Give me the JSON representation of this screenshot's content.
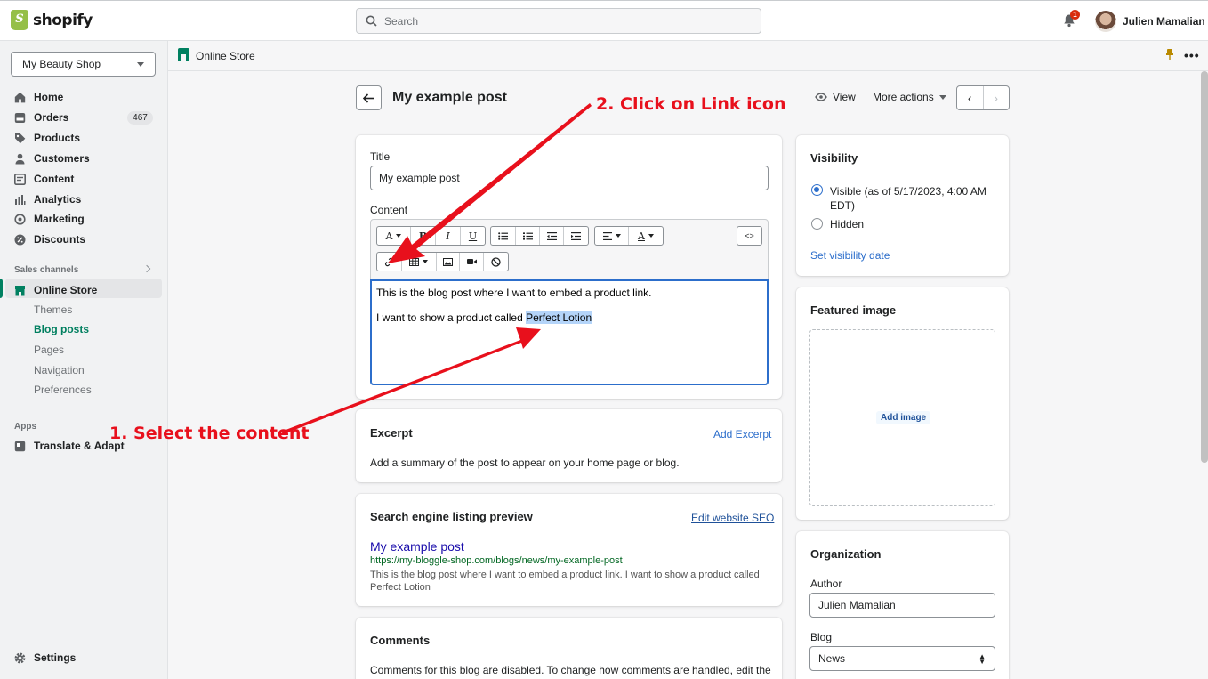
{
  "topbar": {
    "brand": "shopify",
    "search_placeholder": "Search",
    "notification_count": "1",
    "user_name": "Julien Mamalian"
  },
  "sidebar": {
    "store_name": "My Beauty Shop",
    "items": [
      {
        "label": "Home",
        "icon": "home-icon"
      },
      {
        "label": "Orders",
        "icon": "orders-icon",
        "badge": "467"
      },
      {
        "label": "Products",
        "icon": "tag-icon"
      },
      {
        "label": "Customers",
        "icon": "person-icon"
      },
      {
        "label": "Content",
        "icon": "content-icon"
      },
      {
        "label": "Analytics",
        "icon": "analytics-icon"
      },
      {
        "label": "Marketing",
        "icon": "marketing-icon"
      },
      {
        "label": "Discounts",
        "icon": "discount-icon"
      }
    ],
    "sales_channels_label": "Sales channels",
    "online_store_label": "Online Store",
    "sub_items": [
      "Themes",
      "Blog posts",
      "Pages",
      "Navigation",
      "Preferences"
    ],
    "active_sub_item": "Blog posts",
    "apps_label": "Apps",
    "app_item": "Translate & Adapt",
    "settings_label": "Settings"
  },
  "subbar": {
    "title": "Online Store"
  },
  "page": {
    "title": "My example post",
    "view_label": "View",
    "more_actions_label": "More actions"
  },
  "post_card": {
    "title_label": "Title",
    "title_value": "My example post",
    "content_label": "Content",
    "paragraph1": "This is the blog post where I want to embed a product link.",
    "paragraph2_prefix": "I want to show a product called ",
    "paragraph2_selected": "Perfect Lotion"
  },
  "excerpt_card": {
    "heading": "Excerpt",
    "action": "Add Excerpt",
    "description": "Add a summary of the post to appear on your home page or blog."
  },
  "seo_card": {
    "heading": "Search engine listing preview",
    "action": "Edit website SEO",
    "preview_title": "My example post",
    "preview_url": "https://my-bloggle-shop.com/blogs/news/my-example-post",
    "preview_description": "This is the blog post where I want to embed a product link. I want to show a product called Perfect Lotion"
  },
  "comments_card": {
    "heading": "Comments",
    "text": "Comments for this blog are disabled. To change how comments are handled, edit the"
  },
  "visibility_card": {
    "heading": "Visibility",
    "visible_label": "Visible (as of 5/17/2023, 4:00 AM EDT)",
    "hidden_label": "Hidden",
    "set_date_label": "Set visibility date"
  },
  "featured_card": {
    "heading": "Featured image",
    "add_image": "Add image"
  },
  "organization_card": {
    "heading": "Organization",
    "author_label": "Author",
    "author_value": "Julien Mamalian",
    "blog_label": "Blog",
    "blog_value": "News"
  },
  "annotations": {
    "step1": "1. Select the content",
    "step2": "2. Click on Link icon"
  },
  "colors": {
    "brand_green": "#95bf47",
    "active_green": "#007f5f",
    "link_blue": "#2c6ecb",
    "annotation_red": "#e8101c"
  }
}
